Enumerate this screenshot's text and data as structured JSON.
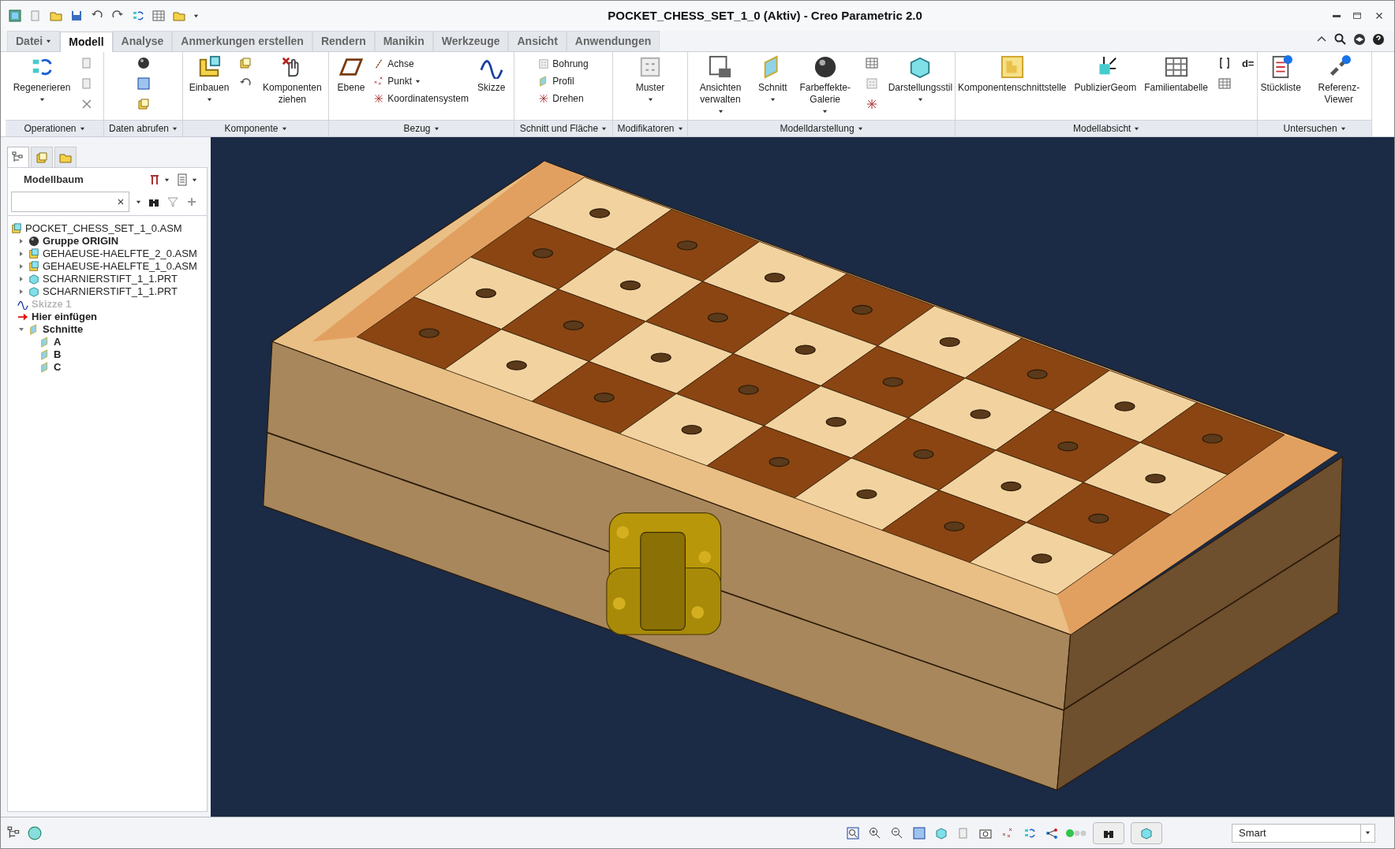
{
  "window": {
    "title": "POCKET_CHESS_SET_1_0 (Aktiv) - Creo Parametric 2.0"
  },
  "tabs": [
    {
      "label": "Datei",
      "kind": "menu",
      "selected": false
    },
    {
      "label": "Modell",
      "kind": "tab",
      "selected": true
    },
    {
      "label": "Analyse",
      "kind": "tab",
      "selected": false
    },
    {
      "label": "Anmerkungen erstellen",
      "kind": "tab",
      "selected": false
    },
    {
      "label": "Rendern",
      "kind": "tab",
      "selected": false
    },
    {
      "label": "Manikin",
      "kind": "tab",
      "selected": false
    },
    {
      "label": "Werkzeuge",
      "kind": "tab",
      "selected": false
    },
    {
      "label": "Ansicht",
      "kind": "tab",
      "selected": false
    },
    {
      "label": "Anwendungen",
      "kind": "tab",
      "selected": false
    }
  ],
  "ribbon": [
    {
      "label": "Operationen",
      "buttons": [
        {
          "label": "Regenerieren",
          "kind": "large",
          "menu": true
        }
      ]
    },
    {
      "label": "Daten abrufen"
    },
    {
      "label": "Komponente",
      "buttons": [
        {
          "label": "Einbauen",
          "kind": "large",
          "menu": true
        },
        {
          "label": "Komponenten ziehen",
          "kind": "large",
          "menu": false
        }
      ]
    },
    {
      "label": "Bezug",
      "buttons": [
        {
          "label": "Ebene",
          "kind": "large",
          "menu": false
        },
        {
          "label": "Achse",
          "kind": "small",
          "menu": false
        },
        {
          "label": "Punkt",
          "kind": "small",
          "menu": true
        },
        {
          "label": "Koordinatensystem",
          "kind": "small",
          "menu": false
        },
        {
          "label": "Skizze",
          "kind": "large",
          "menu": false
        }
      ]
    },
    {
      "label": "Schnitt und Fläche",
      "buttons": [
        {
          "label": "Bohrung",
          "kind": "small",
          "menu": false
        },
        {
          "label": "Profil",
          "kind": "small",
          "menu": false
        },
        {
          "label": "Drehen",
          "kind": "small",
          "menu": false
        }
      ]
    },
    {
      "label": "Modifikatoren",
      "buttons": [
        {
          "label": "Muster",
          "kind": "large",
          "menu": true
        }
      ]
    },
    {
      "label": "Modelldarstellung",
      "buttons": [
        {
          "label": "Ansichten verwalten",
          "kind": "large",
          "menu": true
        },
        {
          "label": "Schnitt",
          "kind": "large",
          "menu": true
        },
        {
          "label": "Farbeffekte-Galerie",
          "kind": "large",
          "menu": true
        },
        {
          "label": "Darstellungsstil",
          "kind": "large",
          "menu": true
        }
      ]
    },
    {
      "label": "Modellabsicht",
      "buttons": [
        {
          "label": "Komponentenschnittstelle",
          "kind": "large",
          "menu": false
        },
        {
          "label": "PublizierGeom",
          "kind": "large",
          "menu": false
        },
        {
          "label": "Familientabelle",
          "kind": "large",
          "menu": false
        },
        {
          "label": "d=",
          "kind": "glyph"
        }
      ]
    },
    {
      "label": "Untersuchen",
      "buttons": [
        {
          "label": "Stückliste",
          "kind": "large",
          "menu": false
        },
        {
          "label": "Referenz-Viewer",
          "kind": "large",
          "menu": false
        }
      ]
    }
  ],
  "panel": {
    "tabs": [
      {
        "selected": true
      },
      {
        "selected": false
      },
      {
        "selected": false
      }
    ],
    "title": "Modellbaum",
    "tree": [
      {
        "label": "POCKET_CHESS_SET_1_0.ASM",
        "kind": "assembly",
        "disabled": false,
        "children": [
          {
            "label": "Gruppe ORIGIN",
            "kind": "group",
            "expanded": false,
            "disabled": false
          },
          {
            "label": "GEHAEUSE-HAELFTE_2_0.ASM",
            "kind": "assembly",
            "expanded": false,
            "disabled": false
          },
          {
            "label": "GEHAEUSE-HAELFTE_1_0.ASM",
            "kind": "assembly",
            "expanded": false,
            "disabled": false
          },
          {
            "label": "SCHARNIERSTIFT_1_1.PRT",
            "kind": "part",
            "expanded": false,
            "disabled": false
          },
          {
            "label": "SCHARNIERSTIFT_1_1.PRT",
            "kind": "part",
            "expanded": false,
            "disabled": false
          },
          {
            "label": "Skizze 1",
            "kind": "sketch",
            "disabled": true
          },
          {
            "label": "Hier einfügen",
            "kind": "insert",
            "disabled": false
          },
          {
            "label": "Schnitte",
            "kind": "sections",
            "expanded": true,
            "disabled": false,
            "children": [
              {
                "label": "A",
                "kind": "section",
                "disabled": false
              },
              {
                "label": "B",
                "kind": "section",
                "disabled": false
              },
              {
                "label": "C",
                "kind": "section",
                "disabled": false
              }
            ]
          }
        ]
      }
    ]
  },
  "status_bar": {
    "filter": {
      "value": "Smart"
    }
  }
}
